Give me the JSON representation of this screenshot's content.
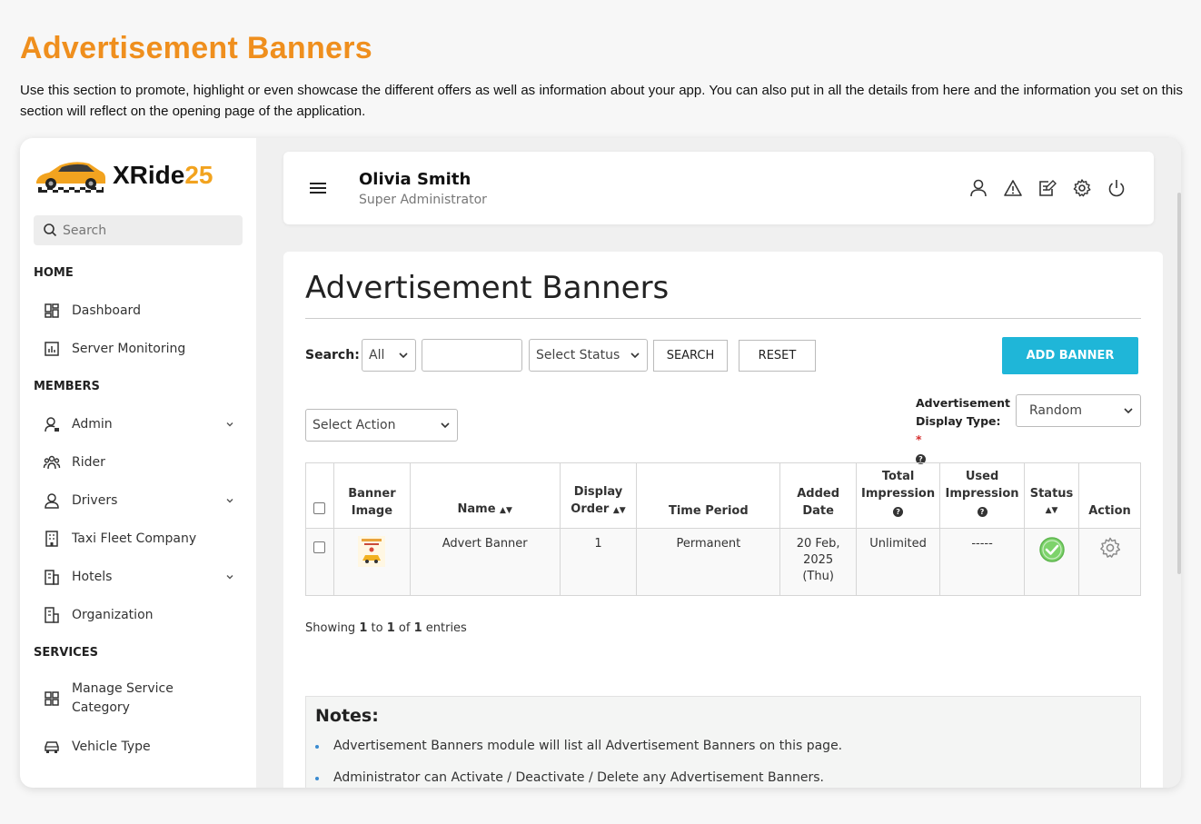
{
  "page": {
    "heading": "Advertisement Banners",
    "description": "Use this section to promote, highlight or even showcase the different offers as well as information about your app. You can also put in all the details from here and the information you set on this section will reflect on the opening page of the application."
  },
  "brand": {
    "name": "XRide",
    "number": "25"
  },
  "sidebar": {
    "search_placeholder": "Search",
    "sections": [
      "HOME",
      "MEMBERS",
      "SERVICES"
    ],
    "items": [
      {
        "label": "Dashboard",
        "icon": "dashboard-icon"
      },
      {
        "label": "Server Monitoring",
        "icon": "chart-icon"
      },
      {
        "label": "Admin",
        "icon": "admin-icon",
        "expandable": true
      },
      {
        "label": "Rider",
        "icon": "rider-icon"
      },
      {
        "label": "Drivers",
        "icon": "driver-icon",
        "expandable": true
      },
      {
        "label": "Taxi Fleet Company",
        "icon": "building-icon"
      },
      {
        "label": "Hotels",
        "icon": "hotel-icon",
        "expandable": true
      },
      {
        "label": "Organization",
        "icon": "organization-icon"
      },
      {
        "label": "Manage Service Category",
        "icon": "grid-icon"
      },
      {
        "label": "Vehicle Type",
        "icon": "car-icon"
      }
    ]
  },
  "topbar": {
    "user_name": "Olivia Smith",
    "user_role": "Super Administrator"
  },
  "main": {
    "title": "Advertisement Banners",
    "search_label": "Search:",
    "filter_select": "All",
    "search_value": "",
    "status_select": "Select Status",
    "search_button": "SEARCH",
    "reset_button": "RESET",
    "add_button": "ADD BANNER",
    "action_select": "Select Action",
    "display_type_label_1": "Advertisement",
    "display_type_label_2": "Display Type:",
    "display_type_required": "*",
    "display_type_value": "Random"
  },
  "table": {
    "headers": {
      "image_1": "Banner",
      "image_2": "Image",
      "name": "Name",
      "order_1": "Display",
      "order_2": "Order",
      "period": "Time Period",
      "added_1": "Added",
      "added_2": "Date",
      "total_1": "Total",
      "total_2": "Impression",
      "used_1": "Used",
      "used_2": "Impression",
      "status": "Status",
      "action": "Action"
    },
    "rows": [
      {
        "name": "Advert Banner",
        "order": "1",
        "period": "Permanent",
        "date_1": "20 Feb,",
        "date_2": "2025",
        "date_3": "(Thu)",
        "total": "Unlimited",
        "used": "-----",
        "status_color": "#7dd36b"
      }
    ]
  },
  "showing": {
    "prefix": "Showing",
    "from": "1",
    "to_word": "to",
    "to": "1",
    "of_word": "of",
    "total": "1",
    "suffix": "entries"
  },
  "notes": {
    "title": "Notes:",
    "items": [
      "Advertisement Banners module will list all Advertisement Banners on this page.",
      "Administrator can Activate / Deactivate / Delete any Advertisement Banners."
    ]
  },
  "colors": {
    "accent": "#ef8f1e",
    "add_button": "#1fb6d8",
    "brand_number": "#f2a31f"
  }
}
